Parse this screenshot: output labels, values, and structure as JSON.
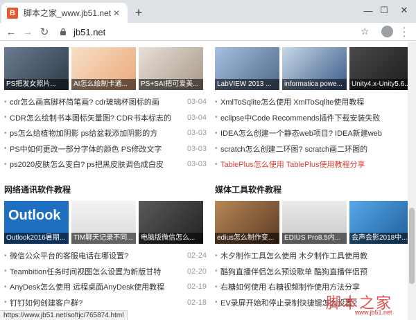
{
  "browser": {
    "tab_title": "脚本之家_www.jb51.net",
    "favicon_text": "B",
    "url": "jb51.net",
    "status_url": "https://www.jb51.net/softjc/765874.html"
  },
  "left_top": {
    "thumbs": [
      {
        "caption": "PS把发女照片...",
        "bg": "#4a5a6e"
      },
      {
        "caption": "AI怎么绘制卡通...",
        "bg": "#f0c8a0"
      },
      {
        "caption": "PS+SAI把可爱美...",
        "bg": "#d8d0c8"
      }
    ],
    "items": [
      {
        "title": "cdr怎么画高脚杯简笔画? cdr玻璃杯图标的画",
        "date": "03-04",
        "red": false
      },
      {
        "title": "CDR怎么绘制书本图标矢量图? CDR书本标志的",
        "date": "03-04",
        "red": false
      },
      {
        "title": "ps怎么给植物加阴影 ps给盆栽添加阴影的方",
        "date": "03-03",
        "red": false
      },
      {
        "title": "PS中如何更改一部分字体的颜色 PS修改文字",
        "date": "03-03",
        "red": false
      },
      {
        "title": "ps2020皮肤怎么变白? ps把黑皮肤调色成白皮",
        "date": "03-03",
        "red": false
      }
    ]
  },
  "right_top": {
    "thumbs": [
      {
        "caption": "LabVIEW 2013 ...",
        "bg": "#7088a8"
      },
      {
        "caption": "informatica powe...",
        "bg": "#5a78a0"
      },
      {
        "caption": "Unity4.x-Unity5.6...",
        "bg": "#2a2a2a"
      }
    ],
    "items": [
      {
        "title": "XmlToSqlite怎么使用 XmlToSqlite使用教程",
        "date": "",
        "red": false
      },
      {
        "title": "eclipse中Code Recommends插件下载安装失败",
        "date": "",
        "red": false
      },
      {
        "title": "IDEA怎么创建一个静态web项目? IDEA新建web",
        "date": "",
        "red": false
      },
      {
        "title": "scratch怎么创建二环图? scratch画二环图的",
        "date": "",
        "red": false
      },
      {
        "title": "TablePlus怎么使用 TablePlus使用教程分享",
        "date": "",
        "red": true
      }
    ]
  },
  "left_bottom": {
    "section_title": "网络通讯软件教程",
    "thumbs": [
      {
        "caption": "Outlook2016暑期...",
        "bg": "#1f6fc0"
      },
      {
        "caption": "TIM聊天记录不同...",
        "bg": "#e8e8e8"
      },
      {
        "caption": "电脑版微信怎么...",
        "bg": "#3c3c3c"
      }
    ],
    "items": [
      {
        "title": "微信公众平台的客服电话在哪设置?",
        "date": "02-24",
        "red": false
      },
      {
        "title": "Teambition任务时间视图怎么设置为新版甘特",
        "date": "02-20",
        "red": false
      },
      {
        "title": "AnyDesk怎么使用 远程桌面AnyDesk使用教程",
        "date": "02-19",
        "red": false
      },
      {
        "title": "钉钉如何创建客户群?",
        "date": "02-18",
        "red": false
      }
    ]
  },
  "right_bottom": {
    "section_title": "媒体工具软件教程",
    "thumbs": [
      {
        "caption": "edius怎么制作变...",
        "bg": "#8a5a3a"
      },
      {
        "caption": "EDIUS Pro8.5内...",
        "bg": "#dcdcdc"
      },
      {
        "caption": "会声会影2018中...",
        "bg": "#2a7ab8"
      }
    ],
    "items": [
      {
        "title": "木夕制作工具怎么使用 木夕制作工具使用教",
        "date": "",
        "red": false
      },
      {
        "title": "酷狗直播伴侣怎么预设歌单 酷狗直播伴侣预",
        "date": "",
        "red": false
      },
      {
        "title": "右糖如何使用 右糖视频制作使用方法分享",
        "date": "",
        "red": false
      },
      {
        "title": "EV录屏开始和停止录制快捷键怎么设置?",
        "date": "",
        "red": false
      }
    ]
  },
  "watermark": {
    "text": "脚本之家",
    "sub": "www.jb51.net"
  }
}
